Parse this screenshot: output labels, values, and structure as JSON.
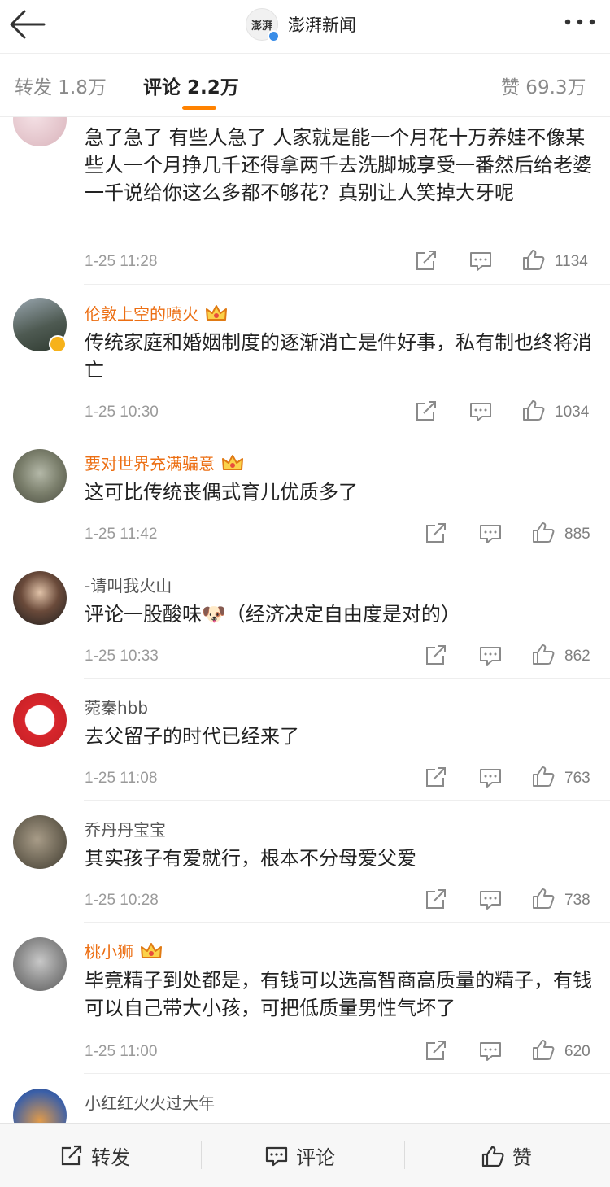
{
  "header": {
    "account_name": "澎湃新闻",
    "logo_text": "澎湃"
  },
  "tabs": [
    {
      "label": "转发 1.8万"
    },
    {
      "label": "评论 2.2万"
    },
    {
      "label": "赞 69.3万"
    }
  ],
  "comments": [
    {
      "username": "",
      "text": "急了急了 有些人急了 人家就是能一个月花十万养娃不像某些人一个月挣几千还得拿两千去洗脚城享受一番然后给老婆一千说给你这么多都不够花？真别让人笑掉大牙呢",
      "time": "1-25 11:28",
      "likes": "1134"
    },
    {
      "username": "伦敦上空的喷火",
      "text": "传统家庭和婚姻制度的逐渐消亡是件好事，私有制也终将消亡",
      "time": "1-25 10:30",
      "likes": "1034"
    },
    {
      "username": "要对世界充满骗意",
      "text": "这可比传统丧偶式育儿优质多了",
      "time": "1-25 11:42",
      "likes": "885"
    },
    {
      "username": "-请叫我火山",
      "text": "评论一股酸味🐶（经济决定自由度是对的）",
      "time": "1-25 10:33",
      "likes": "862"
    },
    {
      "username": "菀秦hbb",
      "text": "去父留子的时代已经来了",
      "time": "1-25 11:08",
      "likes": "763"
    },
    {
      "username": "乔丹丹宝宝",
      "text": "其实孩子有爱就行，根本不分母爱父爱",
      "time": "1-25 10:28",
      "likes": "738"
    },
    {
      "username": "桃小狮",
      "text": "毕竟精子到处都是，有钱可以选高智商高质量的精子，有钱可以自己带大小孩，可把低质量男性气坏了",
      "time": "1-25 11:00",
      "likes": "620"
    },
    {
      "username": "小红红火火过大年",
      "text": "",
      "time": "",
      "likes": ""
    }
  ],
  "bottom_bar": {
    "repost_label": "转发",
    "comment_label": "评论",
    "like_label": "赞"
  },
  "colors": {
    "accent": "#ff8200",
    "vip_name": "#ec6e12"
  }
}
